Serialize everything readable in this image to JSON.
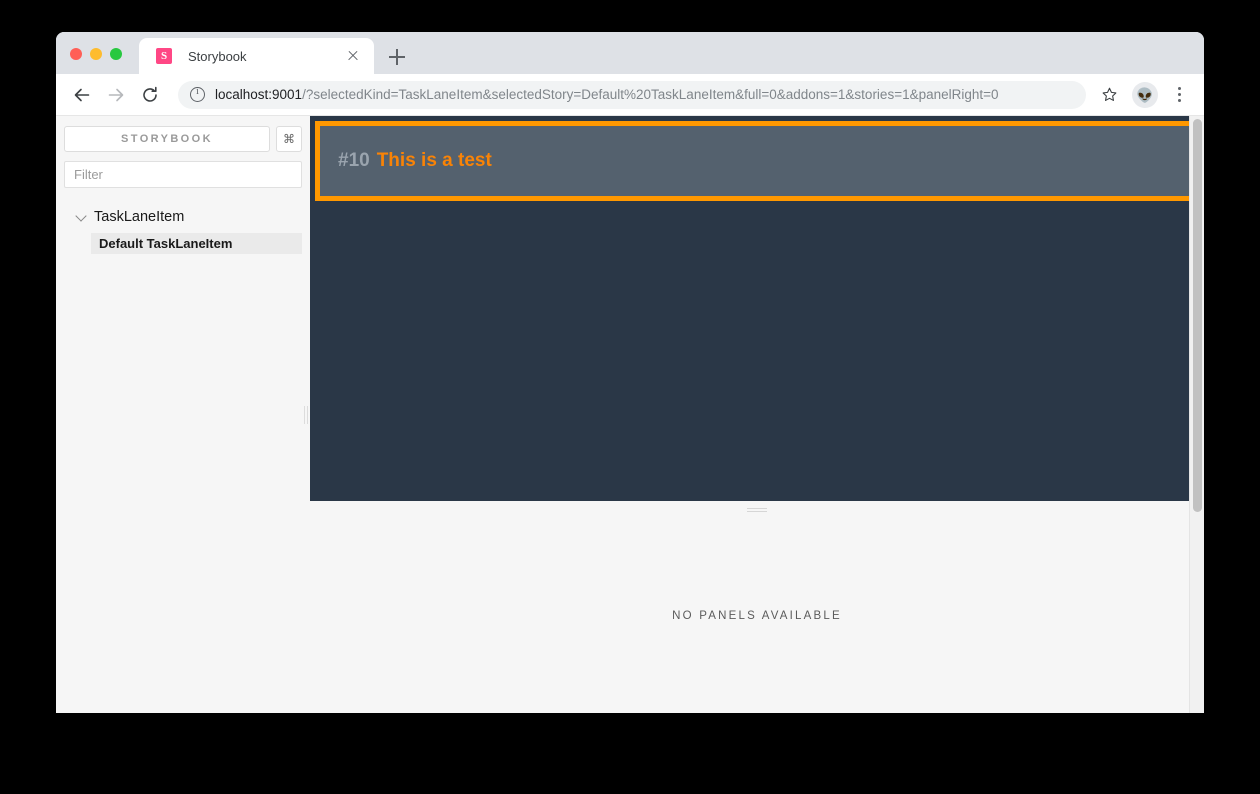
{
  "window": {
    "traffic_lights": [
      "close",
      "minimize",
      "zoom"
    ]
  },
  "tab": {
    "title": "Storybook",
    "favicon_letter": "S",
    "favicon_color": "#ff4785",
    "close_icon": "close-icon",
    "new_tab_icon": "plus-icon"
  },
  "toolbar": {
    "back_icon": "arrow-left-icon",
    "forward_icon": "arrow-right-icon",
    "reload_icon": "reload-icon",
    "site_info_icon": "info-circle-icon",
    "url_host": "localhost:9001",
    "url_path": "/?selectedKind=TaskLaneItem&selectedStory=Default%20TaskLaneItem&full=0&addons=1&stories=1&panelRight=0",
    "bookmark_icon": "star-icon",
    "profile_icon": "👽",
    "menu_icon": "kebab-menu-icon"
  },
  "sidebar": {
    "brand": "STORYBOOK",
    "shortcut_label": "⌘",
    "filter_placeholder": "Filter",
    "filter_value": "",
    "tree": {
      "kind": "TaskLaneItem",
      "expanded": true,
      "stories": [
        {
          "label": "Default TaskLaneItem",
          "selected": true
        }
      ]
    }
  },
  "preview": {
    "background_color": "#2a3747",
    "item": {
      "number": "#10",
      "title": "This is a test",
      "border_color": "#ff9800",
      "background_color": "#54616e",
      "number_color": "#9aa4ae",
      "title_color": "#f98306"
    }
  },
  "panel": {
    "empty_message": "NO PANELS AVAILABLE"
  }
}
